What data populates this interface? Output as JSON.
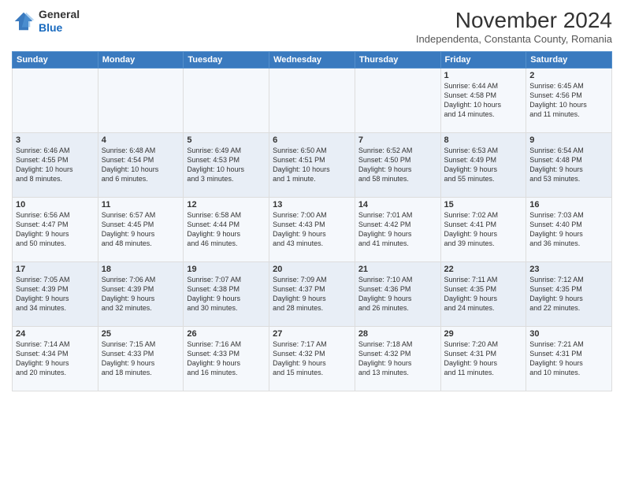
{
  "logo": {
    "line1": "General",
    "line2": "Blue"
  },
  "header": {
    "title": "November 2024",
    "location": "Independenta, Constanta County, Romania"
  },
  "weekdays": [
    "Sunday",
    "Monday",
    "Tuesday",
    "Wednesday",
    "Thursday",
    "Friday",
    "Saturday"
  ],
  "weeks": [
    [
      {
        "day": "",
        "info": ""
      },
      {
        "day": "",
        "info": ""
      },
      {
        "day": "",
        "info": ""
      },
      {
        "day": "",
        "info": ""
      },
      {
        "day": "",
        "info": ""
      },
      {
        "day": "1",
        "info": "Sunrise: 6:44 AM\nSunset: 4:58 PM\nDaylight: 10 hours\nand 14 minutes."
      },
      {
        "day": "2",
        "info": "Sunrise: 6:45 AM\nSunset: 4:56 PM\nDaylight: 10 hours\nand 11 minutes."
      }
    ],
    [
      {
        "day": "3",
        "info": "Sunrise: 6:46 AM\nSunset: 4:55 PM\nDaylight: 10 hours\nand 8 minutes."
      },
      {
        "day": "4",
        "info": "Sunrise: 6:48 AM\nSunset: 4:54 PM\nDaylight: 10 hours\nand 6 minutes."
      },
      {
        "day": "5",
        "info": "Sunrise: 6:49 AM\nSunset: 4:53 PM\nDaylight: 10 hours\nand 3 minutes."
      },
      {
        "day": "6",
        "info": "Sunrise: 6:50 AM\nSunset: 4:51 PM\nDaylight: 10 hours\nand 1 minute."
      },
      {
        "day": "7",
        "info": "Sunrise: 6:52 AM\nSunset: 4:50 PM\nDaylight: 9 hours\nand 58 minutes."
      },
      {
        "day": "8",
        "info": "Sunrise: 6:53 AM\nSunset: 4:49 PM\nDaylight: 9 hours\nand 55 minutes."
      },
      {
        "day": "9",
        "info": "Sunrise: 6:54 AM\nSunset: 4:48 PM\nDaylight: 9 hours\nand 53 minutes."
      }
    ],
    [
      {
        "day": "10",
        "info": "Sunrise: 6:56 AM\nSunset: 4:47 PM\nDaylight: 9 hours\nand 50 minutes."
      },
      {
        "day": "11",
        "info": "Sunrise: 6:57 AM\nSunset: 4:45 PM\nDaylight: 9 hours\nand 48 minutes."
      },
      {
        "day": "12",
        "info": "Sunrise: 6:58 AM\nSunset: 4:44 PM\nDaylight: 9 hours\nand 46 minutes."
      },
      {
        "day": "13",
        "info": "Sunrise: 7:00 AM\nSunset: 4:43 PM\nDaylight: 9 hours\nand 43 minutes."
      },
      {
        "day": "14",
        "info": "Sunrise: 7:01 AM\nSunset: 4:42 PM\nDaylight: 9 hours\nand 41 minutes."
      },
      {
        "day": "15",
        "info": "Sunrise: 7:02 AM\nSunset: 4:41 PM\nDaylight: 9 hours\nand 39 minutes."
      },
      {
        "day": "16",
        "info": "Sunrise: 7:03 AM\nSunset: 4:40 PM\nDaylight: 9 hours\nand 36 minutes."
      }
    ],
    [
      {
        "day": "17",
        "info": "Sunrise: 7:05 AM\nSunset: 4:39 PM\nDaylight: 9 hours\nand 34 minutes."
      },
      {
        "day": "18",
        "info": "Sunrise: 7:06 AM\nSunset: 4:39 PM\nDaylight: 9 hours\nand 32 minutes."
      },
      {
        "day": "19",
        "info": "Sunrise: 7:07 AM\nSunset: 4:38 PM\nDaylight: 9 hours\nand 30 minutes."
      },
      {
        "day": "20",
        "info": "Sunrise: 7:09 AM\nSunset: 4:37 PM\nDaylight: 9 hours\nand 28 minutes."
      },
      {
        "day": "21",
        "info": "Sunrise: 7:10 AM\nSunset: 4:36 PM\nDaylight: 9 hours\nand 26 minutes."
      },
      {
        "day": "22",
        "info": "Sunrise: 7:11 AM\nSunset: 4:35 PM\nDaylight: 9 hours\nand 24 minutes."
      },
      {
        "day": "23",
        "info": "Sunrise: 7:12 AM\nSunset: 4:35 PM\nDaylight: 9 hours\nand 22 minutes."
      }
    ],
    [
      {
        "day": "24",
        "info": "Sunrise: 7:14 AM\nSunset: 4:34 PM\nDaylight: 9 hours\nand 20 minutes."
      },
      {
        "day": "25",
        "info": "Sunrise: 7:15 AM\nSunset: 4:33 PM\nDaylight: 9 hours\nand 18 minutes."
      },
      {
        "day": "26",
        "info": "Sunrise: 7:16 AM\nSunset: 4:33 PM\nDaylight: 9 hours\nand 16 minutes."
      },
      {
        "day": "27",
        "info": "Sunrise: 7:17 AM\nSunset: 4:32 PM\nDaylight: 9 hours\nand 15 minutes."
      },
      {
        "day": "28",
        "info": "Sunrise: 7:18 AM\nSunset: 4:32 PM\nDaylight: 9 hours\nand 13 minutes."
      },
      {
        "day": "29",
        "info": "Sunrise: 7:20 AM\nSunset: 4:31 PM\nDaylight: 9 hours\nand 11 minutes."
      },
      {
        "day": "30",
        "info": "Sunrise: 7:21 AM\nSunset: 4:31 PM\nDaylight: 9 hours\nand 10 minutes."
      }
    ]
  ]
}
